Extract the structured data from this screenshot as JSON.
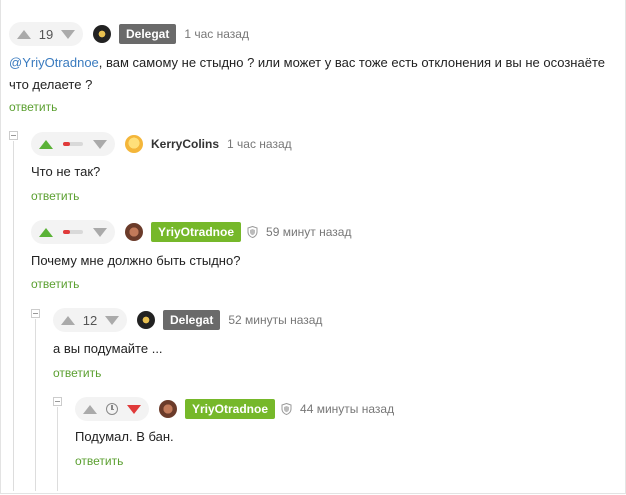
{
  "comments": [
    {
      "score": "19",
      "author": "Delegat",
      "time": "1 час назад",
      "mention": "@YriyOtradnoe",
      "text": ", вам самому не стыдно ? или может у вас тоже есть отклонения и вы не осознаёте",
      "text_line2": "что делаете ?",
      "reply": "ответить"
    },
    {
      "author": "KerryColins",
      "time": "1 час назад",
      "text": "Что не так?",
      "reply": "ответить"
    },
    {
      "author": "YriyOtradnoe",
      "time": "59 минут назад",
      "text": "Почему мне должно быть стыдно?",
      "reply": "ответить"
    },
    {
      "score": "12",
      "author": "Delegat",
      "time": "52 минуты назад",
      "text": "а вы подумайте ...",
      "reply": "ответить"
    },
    {
      "author": "YriyOtradnoe",
      "time": "44 минуты назад",
      "text": "Подумал. В бан.",
      "reply": "ответить"
    }
  ],
  "colors": {
    "upvote": "#5ab236",
    "downvote": "#e03a3a",
    "reply_link": "#5a9f2f",
    "mention": "#3a7bbf",
    "badge_owner": "#76b82a",
    "badge_default": "#6a6a6a"
  },
  "icons": [
    "upvote-arrow",
    "downvote-arrow",
    "rating-bar",
    "clock-icon",
    "shield-icon",
    "collapse-icon"
  ]
}
